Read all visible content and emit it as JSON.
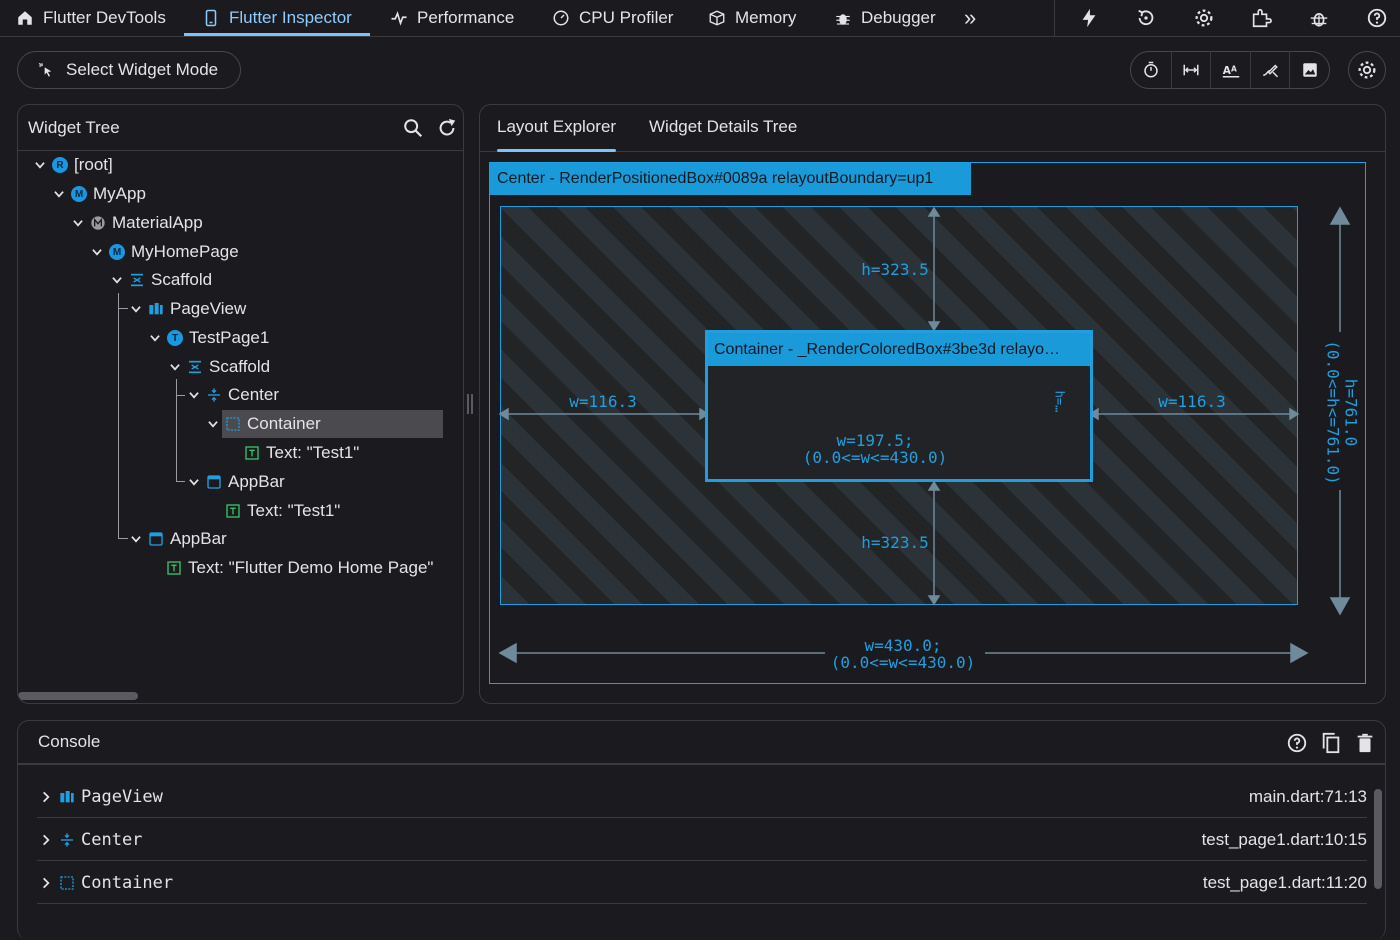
{
  "topbar": {
    "tabs": [
      {
        "label": "Flutter DevTools",
        "icon": "home-icon"
      },
      {
        "label": "Flutter Inspector",
        "icon": "phone-icon",
        "active": true
      },
      {
        "label": "Performance",
        "icon": "pulse-icon"
      },
      {
        "label": "CPU Profiler",
        "icon": "gauge-icon"
      },
      {
        "label": "Memory",
        "icon": "box-icon"
      },
      {
        "label": "Debugger",
        "icon": "bug-icon"
      }
    ],
    "more": "»"
  },
  "toolbar": {
    "select_mode_label": "Select Widget Mode"
  },
  "widget_tree": {
    "title": "Widget Tree",
    "rows": [
      {
        "label": "[root]",
        "badge": "R"
      },
      {
        "label": "MyApp",
        "badge": "M"
      },
      {
        "label": "MaterialApp"
      },
      {
        "label": "MyHomePage",
        "badge": "M"
      },
      {
        "label": "Scaffold"
      },
      {
        "label": "PageView"
      },
      {
        "label": "TestPage1",
        "badge": "T"
      },
      {
        "label": "Scaffold"
      },
      {
        "label": "Center"
      },
      {
        "label": "Container",
        "selected": true
      },
      {
        "label": "Text: \"Test1\""
      },
      {
        "label": "AppBar"
      },
      {
        "label": "Text: \"Test1\""
      },
      {
        "label": "AppBar"
      },
      {
        "label": "Text: \"Flutter Demo Home Page\""
      }
    ]
  },
  "layout_explorer": {
    "tabs": [
      "Layout Explorer",
      "Widget Details Tree"
    ],
    "center_header": "Center - RenderPositionedBox#0089a relayoutBoundary=up1",
    "container_header": "Container - _RenderColoredBox#3be3d relayo…",
    "top_h": "h=323.5",
    "bottom_h": "h=323.5",
    "left_w": "w=116.3",
    "right_w": "w=116.3",
    "inner_w": "w=197.5;",
    "inner_w_constraint": "(0.0<=w<=430.0)",
    "inner_h": "h=…",
    "outer_w": "w=430.0;",
    "outer_w_constraint": "(0.0<=w<=430.0)",
    "outer_h": "h=761.0",
    "outer_h_constraint": "(0.0<=h<=761.0)"
  },
  "console": {
    "title": "Console",
    "rows": [
      {
        "label": "PageView",
        "source": "main.dart:71:13"
      },
      {
        "label": "Center",
        "source": "test_page1.dart:10:15"
      },
      {
        "label": "Container",
        "source": "test_page1.dart:11:20"
      }
    ]
  },
  "colors": {
    "accent": "#1f9fe0",
    "selected_tab": "#8ecbff",
    "widget_green": "#33c46a",
    "background": "#1b1b1f"
  }
}
